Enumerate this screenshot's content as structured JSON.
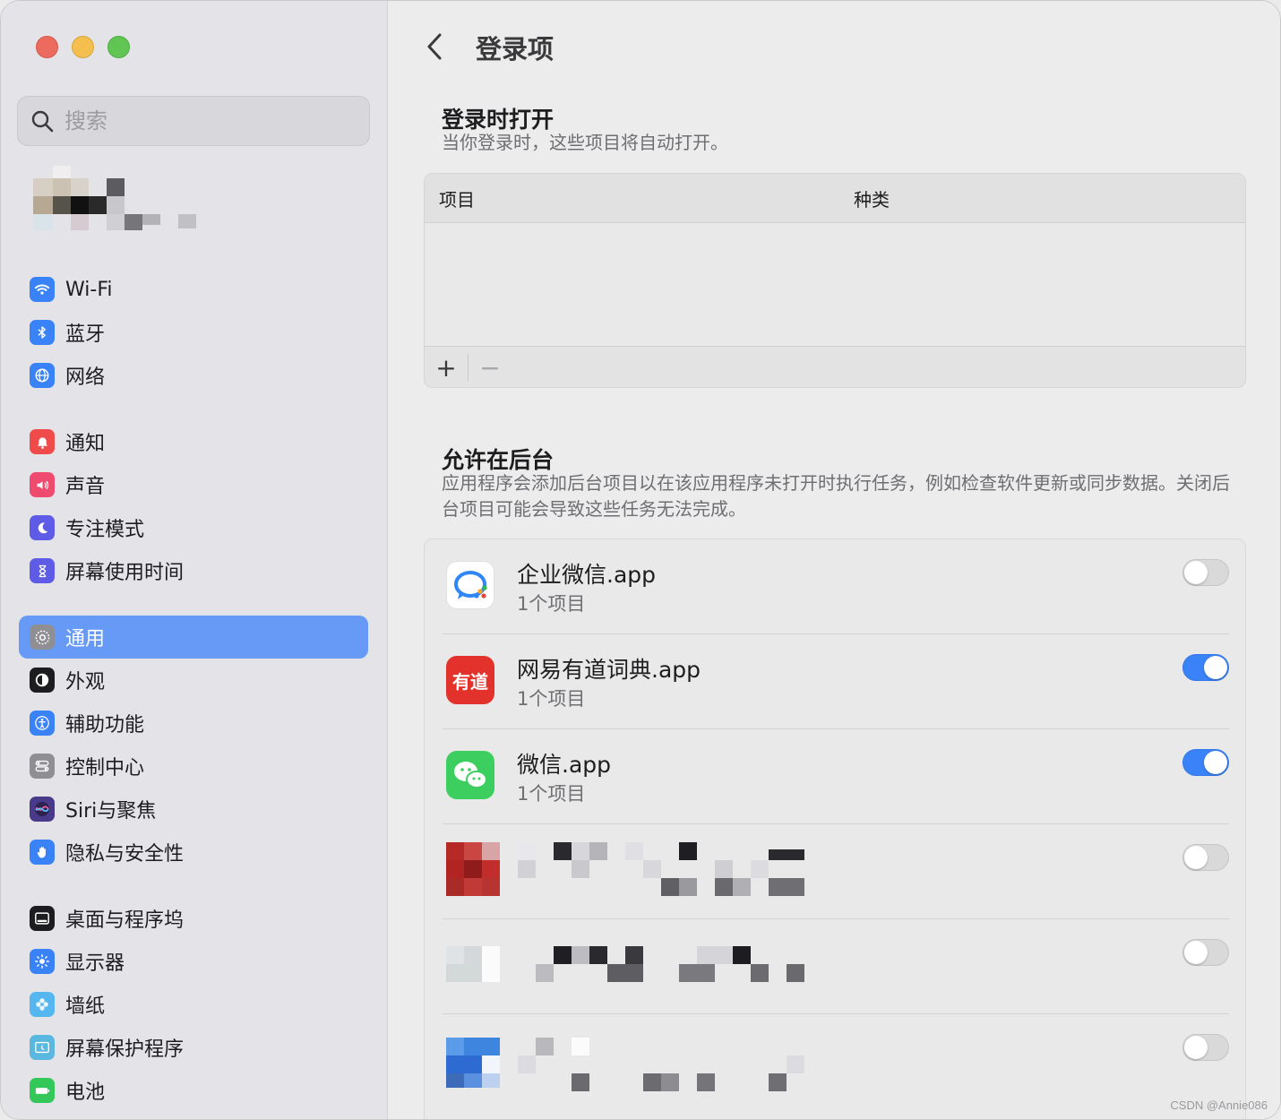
{
  "search": {
    "placeholder": "搜索"
  },
  "sidebar": {
    "groups": [
      [
        {
          "label": "Wi-Fi",
          "icon": "wifi-icon",
          "color": "#3a82f7"
        },
        {
          "label": "蓝牙",
          "icon": "bluetooth-icon",
          "color": "#3a82f7"
        },
        {
          "label": "网络",
          "icon": "globe-icon",
          "color": "#3a82f7"
        }
      ],
      [
        {
          "label": "通知",
          "icon": "bell-icon",
          "color": "#ef4b4b"
        },
        {
          "label": "声音",
          "icon": "speaker-icon",
          "color": "#ef4b6e"
        },
        {
          "label": "专注模式",
          "icon": "moon-icon",
          "color": "#5e5ce6"
        },
        {
          "label": "屏幕使用时间",
          "icon": "hourglass-icon",
          "color": "#5e5ce6"
        }
      ],
      [
        {
          "label": "通用",
          "icon": "gear-icon",
          "color": "#8e8e93",
          "active": true
        },
        {
          "label": "外观",
          "icon": "appearance-icon",
          "color": "#1d1d1f"
        },
        {
          "label": "辅助功能",
          "icon": "accessibility-icon",
          "color": "#3a82f7"
        },
        {
          "label": "控制中心",
          "icon": "control-center-icon",
          "color": "#8e8e93"
        },
        {
          "label": "Siri与聚焦",
          "icon": "siri-icon",
          "color": "#4a3a8a"
        },
        {
          "label": "隐私与安全性",
          "icon": "hand-icon",
          "color": "#3a82f7"
        }
      ],
      [
        {
          "label": "桌面与程序坞",
          "icon": "dock-icon",
          "color": "#1d1d1f"
        },
        {
          "label": "显示器",
          "icon": "sun-icon",
          "color": "#3a82f7"
        },
        {
          "label": "墙纸",
          "icon": "flower-icon",
          "color": "#55b6f0"
        },
        {
          "label": "屏幕保护程序",
          "icon": "screensaver-icon",
          "color": "#5ab8e0"
        },
        {
          "label": "电池",
          "icon": "battery-icon",
          "color": "#34c759"
        }
      ]
    ]
  },
  "main": {
    "title": "登录项",
    "login_section": {
      "title": "登录时打开",
      "desc": "当你登录时，这些项目将自动打开。",
      "col_item": "项目",
      "col_kind": "种类",
      "add": "+",
      "remove": "−"
    },
    "background_section": {
      "title": "允许在后台",
      "desc": "应用程序会添加后台项目以在该应用程序未打开时执行任务，例如检查软件更新或同步数据。关闭后台项目可能会导致这些任务无法完成。"
    },
    "apps": [
      {
        "name": "企业微信.app",
        "sub": "1个项目",
        "enabled": false
      },
      {
        "name": "网易有道词典.app",
        "sub": "1个项目",
        "enabled": true,
        "icon_text": "有道"
      },
      {
        "name": "微信.app",
        "sub": "1个项目",
        "enabled": true
      },
      {
        "enabled": false
      },
      {
        "enabled": false
      },
      {
        "enabled": false
      }
    ]
  },
  "watermark": "CSDN @Annie086"
}
